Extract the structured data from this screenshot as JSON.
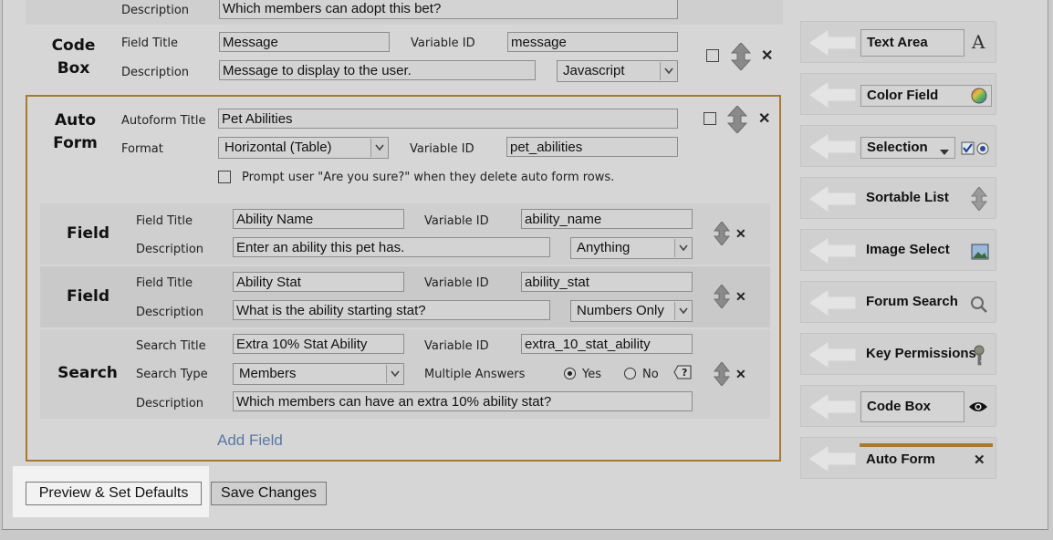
{
  "top_row": {
    "description_label": "Description",
    "description_value": "Which members can adopt this bet?"
  },
  "code_box": {
    "title_line1": "Code",
    "title_line2": "Box",
    "field_title_label": "Field Title",
    "field_title_value": "Message",
    "variable_id_label": "Variable ID",
    "variable_id_value": "message",
    "description_label": "Description",
    "description_value": "Message to display to the user.",
    "type_selected": "Javascript"
  },
  "auto_form": {
    "title_line1": "Auto",
    "title_line2": "Form",
    "autoform_title_label": "Autoform Title",
    "autoform_title_value": "Pet Abilities",
    "format_label": "Format",
    "format_selected": "Horizontal (Table)",
    "variable_id_label": "Variable ID",
    "variable_id_value": "pet_abilities",
    "prompt_label": "Prompt user \"Are you sure?\" when they delete auto form rows.",
    "fields": [
      {
        "title": "Field",
        "field_title_label": "Field Title",
        "field_title_value": "Ability Name",
        "variable_id_label": "Variable ID",
        "variable_id_value": "ability_name",
        "description_label": "Description",
        "description_value": "Enter an ability this pet has.",
        "type_selected": "Anything"
      },
      {
        "title": "Field",
        "field_title_label": "Field Title",
        "field_title_value": "Ability Stat",
        "variable_id_label": "Variable ID",
        "variable_id_value": "ability_stat",
        "description_label": "Description",
        "description_value": "What is the ability starting stat?",
        "type_selected": "Numbers Only"
      }
    ],
    "search": {
      "title": "Search",
      "search_title_label": "Search Title",
      "search_title_value": "Extra 10% Stat Ability",
      "variable_id_label": "Variable ID",
      "variable_id_value": "extra_10_stat_ability",
      "search_type_label": "Search Type",
      "search_type_selected": "Members",
      "multiple_answers_label": "Multiple Answers",
      "yes_label": "Yes",
      "no_label": "No",
      "description_label": "Description",
      "description_value": "Which members can have an extra 10% ability stat?"
    },
    "add_field_label": "Add Field"
  },
  "buttons": {
    "preview": "Preview & Set Defaults",
    "save": "Save Changes"
  },
  "palette": [
    {
      "label": "Text Area",
      "icon": "letter-a-icon"
    },
    {
      "label": "Color Field",
      "icon": "color-wheel-icon"
    },
    {
      "label": "Selection",
      "icon": "selection-controls-icon"
    },
    {
      "label": "Sortable List",
      "icon": "sort-arrows-icon"
    },
    {
      "label": "Image Select",
      "icon": "image-icon"
    },
    {
      "label": "Forum Search",
      "icon": "magnifier-icon"
    },
    {
      "label": "Key Permissions",
      "icon": "key-icon"
    },
    {
      "label": "Code Box",
      "icon": "eye-icon"
    },
    {
      "label": "Auto Form",
      "icon": "close-icon"
    }
  ],
  "colors": {
    "accent": "#a77a2e",
    "link": "#5a78a3",
    "highlight": "#f2f2f2"
  }
}
